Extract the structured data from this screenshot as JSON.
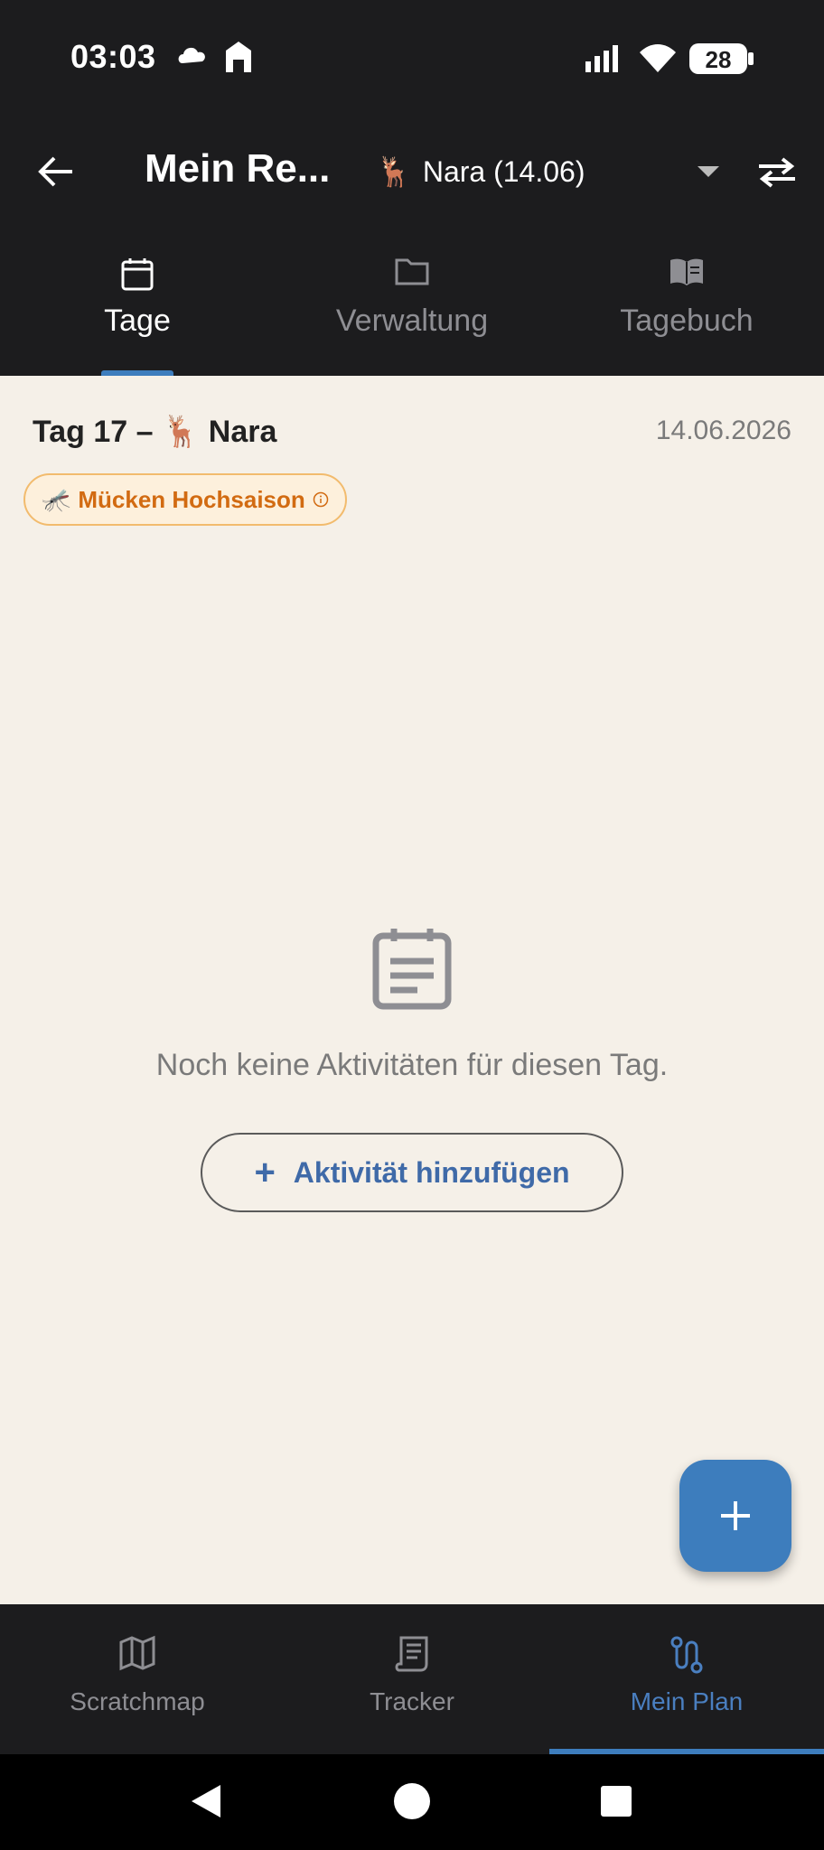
{
  "status": {
    "time": "03:03",
    "battery": "28"
  },
  "appbar": {
    "title": "Mein Re...",
    "destination_emoji": "🦌",
    "destination_label": "Nara (14.06)"
  },
  "tabs": [
    {
      "label": "Tage",
      "icon": "calendar-icon",
      "active": true
    },
    {
      "label": "Verwaltung",
      "icon": "folder-icon",
      "active": false
    },
    {
      "label": "Tagebuch",
      "icon": "book-icon",
      "active": false
    }
  ],
  "day": {
    "title_prefix": "Tag 17 –",
    "emoji": "🦌",
    "name": "Nara",
    "date": "14.06.2026",
    "season_chip": {
      "emoji": "🦟",
      "label": "Mücken Hochsaison"
    }
  },
  "empty_state": {
    "message": "Noch keine Aktivitäten für diesen Tag.",
    "button_label": "Aktivität hinzufügen"
  },
  "bottom_nav": [
    {
      "label": "Scratchmap",
      "icon": "map-icon",
      "active": false
    },
    {
      "label": "Tracker",
      "icon": "receipt-icon",
      "active": false
    },
    {
      "label": "Mein Plan",
      "icon": "route-icon",
      "active": true
    }
  ],
  "colors": {
    "accent": "#3d7dbd",
    "background": "#f5f0e8",
    "chip_text": "#d26b12",
    "dark_bar": "#1c1c1e"
  }
}
